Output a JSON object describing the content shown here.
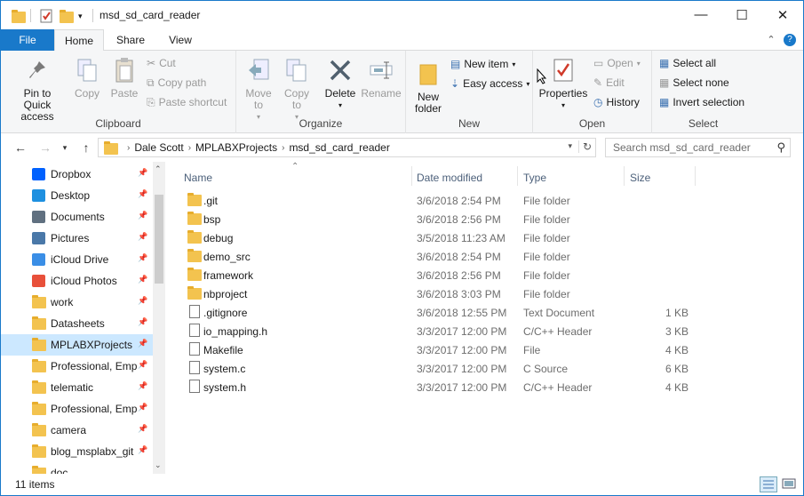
{
  "window": {
    "title": "msd_sd_card_reader"
  },
  "tabs": {
    "file": "File",
    "home": "Home",
    "share": "Share",
    "view": "View"
  },
  "ribbon": {
    "clipboard": {
      "label": "Clipboard",
      "pin": "Pin to Quick access",
      "copy": "Copy",
      "paste": "Paste",
      "cut": "Cut",
      "copy_path": "Copy path",
      "paste_shortcut": "Paste shortcut"
    },
    "organize": {
      "label": "Organize",
      "move_to": "Move to",
      "copy_to": "Copy to",
      "delete": "Delete",
      "rename": "Rename"
    },
    "new": {
      "label": "New",
      "new_folder": "New folder",
      "new_item": "New item",
      "easy_access": "Easy access"
    },
    "open": {
      "label": "Open",
      "properties": "Properties",
      "open": "Open",
      "edit": "Edit",
      "history": "History"
    },
    "select": {
      "label": "Select",
      "select_all": "Select all",
      "select_none": "Select none",
      "invert_selection": "Invert selection"
    }
  },
  "address": {
    "crumbs": [
      "Dale Scott",
      "MPLABXProjects",
      "msd_sd_card_reader"
    ],
    "search_placeholder": "Search msd_sd_card_reader"
  },
  "nav": [
    {
      "label": "Dropbox",
      "icon": "dropbox-icon",
      "color": "#0061fe"
    },
    {
      "label": "Desktop",
      "icon": "desktop-icon",
      "color": "#1e90e0"
    },
    {
      "label": "Documents",
      "icon": "documents-icon",
      "color": "#607080"
    },
    {
      "label": "Pictures",
      "icon": "pictures-icon",
      "color": "#4a78a8"
    },
    {
      "label": "iCloud Drive",
      "icon": "icloud-icon",
      "color": "#3a8ee6"
    },
    {
      "label": "iCloud Photos",
      "icon": "icloud-photos-icon",
      "color": "#e8503a"
    },
    {
      "label": "work",
      "icon": "folder-icon",
      "color": "#f3c34f"
    },
    {
      "label": "Datasheets",
      "icon": "folder-icon",
      "color": "#f3c34f"
    },
    {
      "label": "MPLABXProjects",
      "icon": "folder-icon",
      "color": "#f3c34f"
    },
    {
      "label": "Professional, Empl",
      "icon": "folder-icon",
      "color": "#f3c34f"
    },
    {
      "label": "telematic",
      "icon": "folder-sync-icon",
      "color": "#f3c34f"
    },
    {
      "label": "Professional, Empl",
      "icon": "folder-icon",
      "color": "#f3c34f"
    },
    {
      "label": "camera",
      "icon": "folder-icon",
      "color": "#f3c34f"
    },
    {
      "label": "blog_msplabx_git",
      "icon": "folder-icon",
      "color": "#f3c34f"
    },
    {
      "label": "doc",
      "icon": "folder-icon",
      "color": "#f3c34f"
    }
  ],
  "columns": {
    "name": "Name",
    "date": "Date modified",
    "type": "Type",
    "size": "Size"
  },
  "files": [
    {
      "name": ".git",
      "date": "3/6/2018 2:54 PM",
      "type": "File folder",
      "size": "",
      "icon": "folder-icon"
    },
    {
      "name": "bsp",
      "date": "3/6/2018 2:56 PM",
      "type": "File folder",
      "size": "",
      "icon": "folder-icon"
    },
    {
      "name": "debug",
      "date": "3/5/2018 11:23 AM",
      "type": "File folder",
      "size": "",
      "icon": "folder-icon"
    },
    {
      "name": "demo_src",
      "date": "3/6/2018 2:54 PM",
      "type": "File folder",
      "size": "",
      "icon": "folder-icon"
    },
    {
      "name": "framework",
      "date": "3/6/2018 2:56 PM",
      "type": "File folder",
      "size": "",
      "icon": "folder-icon"
    },
    {
      "name": "nbproject",
      "date": "3/6/2018 3:03 PM",
      "type": "File folder",
      "size": "",
      "icon": "folder-icon"
    },
    {
      "name": ".gitignore",
      "date": "3/6/2018 12:55 PM",
      "type": "Text Document",
      "size": "1 KB",
      "icon": "text-file-icon"
    },
    {
      "name": "io_mapping.h",
      "date": "3/3/2017 12:00 PM",
      "type": "C/C++ Header",
      "size": "3 KB",
      "icon": "header-file-icon"
    },
    {
      "name": "Makefile",
      "date": "3/3/2017 12:00 PM",
      "type": "File",
      "size": "4 KB",
      "icon": "file-icon"
    },
    {
      "name": "system.c",
      "date": "3/3/2017 12:00 PM",
      "type": "C Source",
      "size": "6 KB",
      "icon": "c-file-icon"
    },
    {
      "name": "system.h",
      "date": "3/3/2017 12:00 PM",
      "type": "C/C++ Header",
      "size": "4 KB",
      "icon": "header-file-icon"
    }
  ],
  "status": {
    "count": "11 items"
  }
}
